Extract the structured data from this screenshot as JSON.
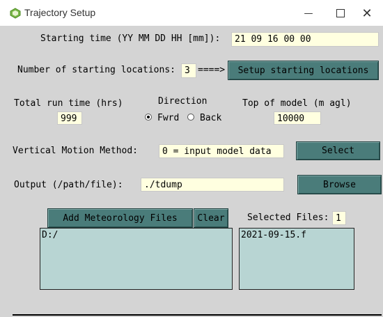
{
  "window": {
    "title": "Trajectory Setup"
  },
  "start_time": {
    "label": "Starting time (YY MM DD HH [mm]):",
    "value": "21 09 16 00 00"
  },
  "locations": {
    "label": "Number of starting locations:",
    "value": "3",
    "arrow": "====>",
    "button": "Setup starting locations"
  },
  "run_time": {
    "label": "Total run time (hrs)",
    "value": "999"
  },
  "direction": {
    "label": "Direction",
    "forward": "Fwrd",
    "back": "Back",
    "selected": "Fwrd"
  },
  "top_model": {
    "label": "Top of model (m agl)",
    "value": "10000"
  },
  "vertical": {
    "label": "Vertical Motion Method:",
    "value": "0 = input model data",
    "button": "Select"
  },
  "output": {
    "label": "Output (/path/file):",
    "value": "./tdump",
    "button": "Browse"
  },
  "met": {
    "add_button": "Add Meteorology Files",
    "clear_button": "Clear",
    "selected_label": "Selected Files:",
    "selected_count": "1",
    "dir_list": [
      "D:/"
    ],
    "file_list": [
      "2021-09-15.f"
    ]
  },
  "colors": {
    "button": "#4a7c7a",
    "field": "#ffffe0",
    "list": "#b8d5d3",
    "window_bg": "#d4d4d4"
  }
}
